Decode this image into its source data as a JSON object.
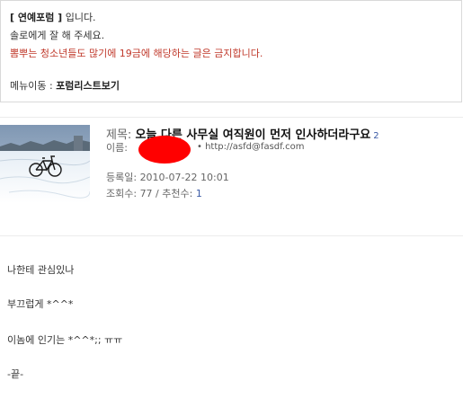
{
  "notice": {
    "forum_name": "[ 연예포럼 ]",
    "forum_suffix": " 입니다.",
    "greeting": "솔로에게 잘 해 주세요.",
    "warning": "뽐뿌는 청소년들도 많기에 19금에 해당하는 글은 금지합니다.",
    "menu_label": "메뉴이동 : ",
    "menu_link": "포럼리스트보기"
  },
  "post": {
    "title_label": "제목: ",
    "title": "오늘 다른 사무실 여직원이 먼저 인사하더라구요",
    "comment_count": "2",
    "name_label": "이름: ",
    "homepage": "http://asfd@fasdf.com",
    "date_label": "등록일: ",
    "date": "2010-07-22 10:01",
    "views_label": "조회수: ",
    "views": "77",
    "separator": " / ",
    "recommend_label": "추천수: ",
    "recommend": "1"
  },
  "body_lines": [
    "나한테 관심있나",
    "부끄럽게  *^^*",
    "이놈에 인기는 *^^*;; ㅠㅠ",
    "-끝-"
  ],
  "colors": {
    "warning": "#c0392b",
    "name_mask": "#ff0000",
    "accent": "#3b5ba5"
  }
}
